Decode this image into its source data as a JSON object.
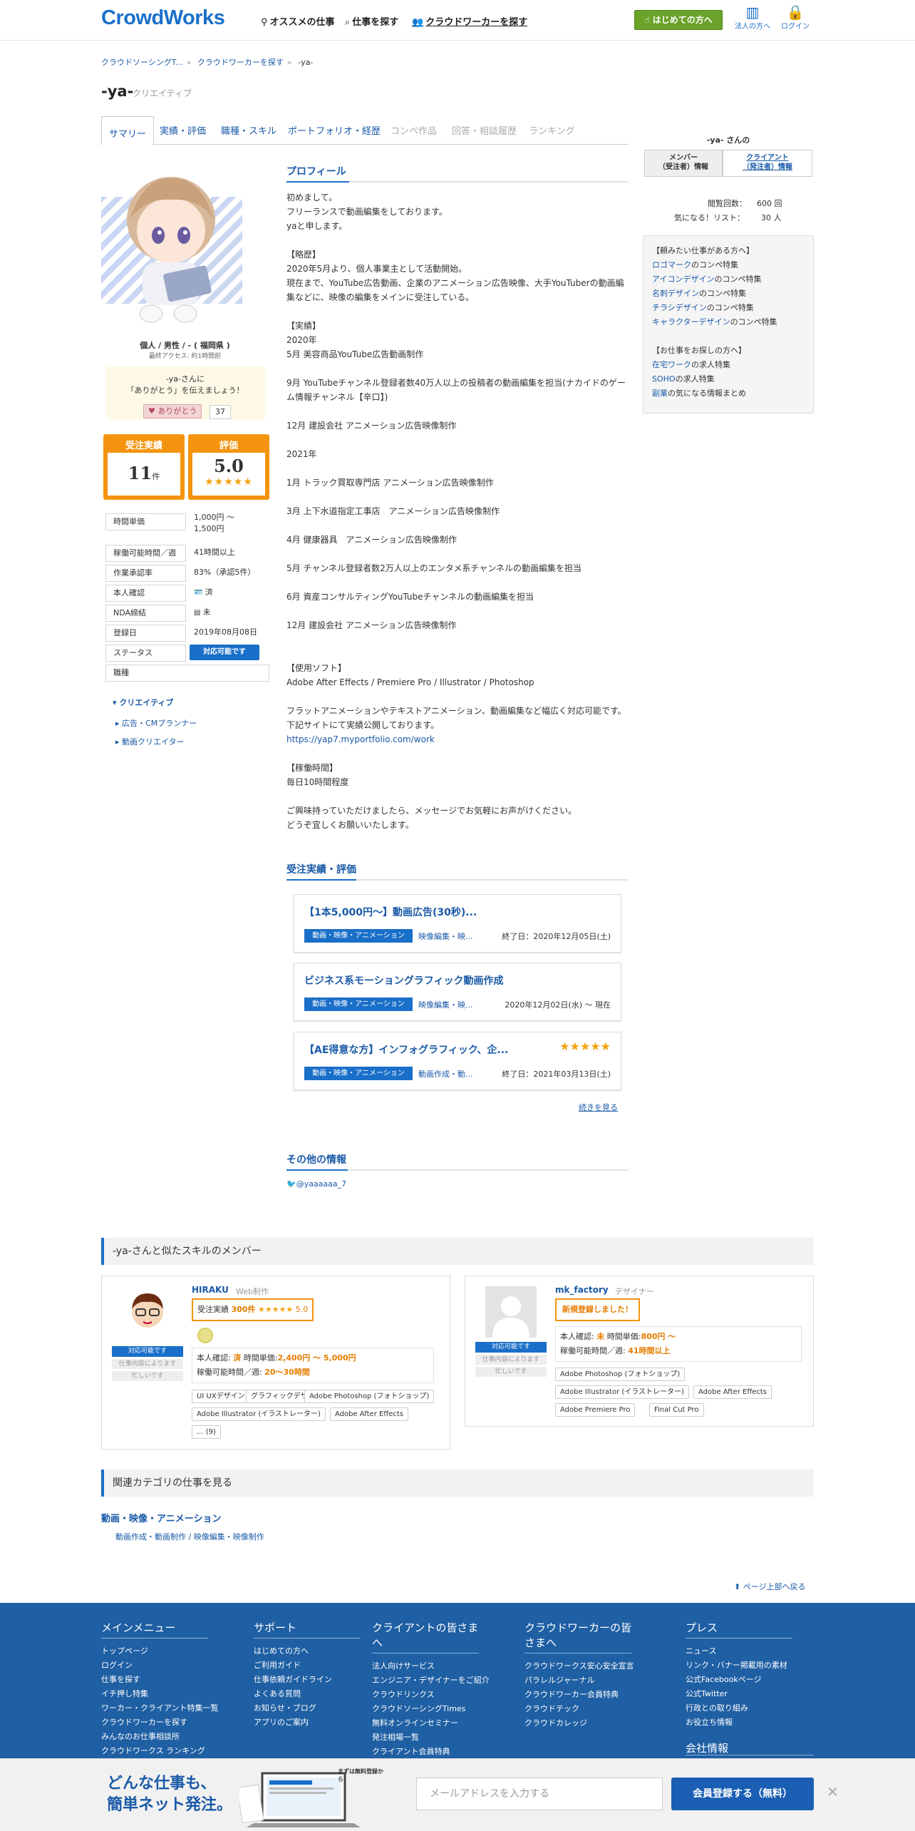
{
  "header": {
    "logo": "CrowdWorks",
    "nav": [
      "オススメの仕事",
      "仕事を探す",
      "クラウドワーカーを探す"
    ],
    "begin_button": "はじめての方へ",
    "corp_label": "法人の方へ",
    "login_label": "ログイン"
  },
  "breadcrumb": [
    "クラウドソーシングT...",
    "クラウドワーカーを探す",
    "-ya-"
  ],
  "profile": {
    "name": "-ya-",
    "type": "クリエイティブ",
    "tabs": [
      "サマリー",
      "実績・評価",
      "職種・スキル",
      "ポートフォリオ・経歴",
      "コンペ作品",
      "回答・相談履歴",
      "ランキング"
    ],
    "info": "個人 / 男性 / - ( 福岡県 )",
    "last_access": "最終アクセス: 約1時間前",
    "thanks_line1": "-ya-さんに",
    "thanks_line2": "「ありがとう」を伝えましょう！",
    "thanks_button": "ありがとう",
    "thanks_count": "37",
    "orders_label": "受注実績",
    "orders_count": "11",
    "orders_unit": "件",
    "rating_label": "評価",
    "rating_value": "5.0",
    "rating_stars": 5
  },
  "details": [
    {
      "k": "時間単価",
      "v": "1,000円 〜",
      "v2": "1,500円"
    },
    {
      "k": "稼働可能時間／週",
      "v": "41時間以上"
    },
    {
      "k": "作業承認率",
      "v": "83%（承認5件）"
    },
    {
      "k": "本人確認",
      "v": "済"
    },
    {
      "k": "NDA締結",
      "v": "未"
    },
    {
      "k": "登録日",
      "v": "2019年08月08日"
    },
    {
      "k": "ステータス",
      "v": "対応可能です"
    },
    {
      "k": "職種",
      "v": ""
    }
  ],
  "categories": {
    "parent": "クリエイティブ",
    "children": [
      "広告・CMプランナー",
      "動画クリエイター"
    ]
  },
  "profile_section": {
    "heading": "プロフィール",
    "text": "初めまして。\nフリーランスで動画編集をしております。\nyaと申します。\n\n【略歴】\n2020年5月より、個人事業主として活動開始。\n現在まで、YouTube広告動画、企業のアニメーション広告映像、大手YouTuberの動画編集などに、映像の編集をメインに受注している。\n\n【実績】\n2020年\n5月 美容商品YouTube広告動画制作\n\n9月 YouTubeチャンネル登録者数40万人以上の投稿者の動画編集を担当(ナカイドのゲーム情報チャンネル【辛口】)\n\n12月 建設会社 アニメーション広告映像制作\n\n2021年\n\n1月 トラック買取専門店 アニメーション広告映像制作\n\n3月 上下水道指定工事店　アニメーション広告映像制作\n\n4月 健康器具　アニメーション広告映像制作\n\n5月 チャンネル登録者数2万人以上のエンタメ系チャンネルの動画編集を担当\n\n6月 資産コンサルティングYouTubeチャンネルの動画編集を担当\n\n12月 建設会社 アニメーション広告映像制作\n\n\n【使用ソフト】\nAdobe After Effects / Premiere Pro / Illustrator / Photoshop\n\nフラットアニメーションやテキストアニメーション、動画編集など幅広く対応可能です。\n下記サイトにて実績公開しております。",
    "link": "https://yap7.myportfolio.com/work",
    "text2": "【稼働時間】\n毎日10時間程度\n\nご興味持っていただけましたら、メッセージでお気軽にお声がけください。\nどうぞ宜しくお願いいたします。"
  },
  "orders_section": {
    "heading": "受注実績・評価",
    "jobs": [
      {
        "title": "【1本5,000円～】動画広告(30秒)...",
        "tag": "動画・映像・アニメーション",
        "cat": "映像編集・映...",
        "date": "終了日：2020年12月05日(土)",
        "stars": 0
      },
      {
        "title": "ビジネス系モーショングラフィック動画作成",
        "tag": "動画・映像・アニメーション",
        "cat": "映像編集・映...",
        "date": "2020年12月02日(水) 〜 現在",
        "stars": 0
      },
      {
        "title": "【AE得意な方】インフォグラフィック、企...",
        "tag": "動画・映像・アニメーション",
        "cat": "動画作成・動...",
        "date": "終了日：2021年03月13日(土)",
        "stars": 5
      }
    ],
    "more": "続きを見る"
  },
  "other_section": {
    "heading": "その他の情報",
    "twitter": "@yaaaaaa_7"
  },
  "sidebar": {
    "title": "-ya- さんの",
    "tab_member": "メンバー\n（受注者）情報",
    "tab_client": "クライアント\n（発注者）情報",
    "views_label": "閲覧回数：",
    "views_value": "600 回",
    "fav_label": "気になる！リスト：",
    "fav_value": "30 人",
    "lines": [
      {
        "t": "【頼みたい仕事がある方へ】",
        "link": ""
      },
      {
        "t": "のコンペ特集",
        "link": "ロゴマーク"
      },
      {
        "t": "のコンペ特集",
        "link": "アイコンデザイン"
      },
      {
        "t": "のコンペ特集",
        "link": "名刺デザイン"
      },
      {
        "t": "のコンペ特集",
        "link": "チラシデザイン"
      },
      {
        "t": "のコンペ特集",
        "link": "キャラクターデザイン"
      },
      {
        "t": "",
        "link": ""
      },
      {
        "t": "【お仕事をお探しの方へ】",
        "link": ""
      },
      {
        "t": "の求人特集",
        "link": "在宅ワーク"
      },
      {
        "t": "の求人特集",
        "link": "SOHO"
      },
      {
        "t": "の気になる情報まとめ",
        "link": "副業"
      }
    ]
  },
  "similar": {
    "heading": "-ya-さんと似たスキルのメンバー",
    "members": [
      {
        "name": "HIRAKU",
        "type": "Web制作",
        "badge_prefix": "受注実績",
        "badge_value": "300件",
        "badge_rating": "5.0",
        "status": "対応可能です",
        "status2": "仕事内容によります",
        "status3": "忙しいです",
        "verify": "本人確認:",
        "verify_v": "済",
        "rate_label": "時間単価:",
        "rate": "2,400円 〜 5,000円",
        "hours_label": "稼働可能時間／週:",
        "hours": "20〜30時間",
        "skills": [
          "UI UXデザイン",
          "グラフィックデザイン",
          "Adobe Photoshop (フォトショップ)",
          "Adobe Illustrator (イラストレーター)",
          "Adobe After Effects",
          "... (9)"
        ]
      },
      {
        "name": "mk_factory",
        "type": "デザイナー",
        "badge_new": "新規登録しました！",
        "status": "対応可能です",
        "status2": "仕事内容によります",
        "status3": "忙しいです",
        "verify": "本人確認:",
        "verify_v": "未",
        "rate_label": "時間単価:",
        "rate": "800円 〜",
        "hours_label": "稼働可能時間／週:",
        "hours": "41時間以上",
        "skills": [
          "Adobe Photoshop (フォトショップ)",
          "Adobe Illustrator (イラストレーター)",
          "Adobe After Effects",
          "Adobe Premiere Pro",
          "Final Cut Pro"
        ]
      }
    ]
  },
  "related": {
    "heading": "関連カテゴリの仕事を見る",
    "category": "動画・映像・アニメーション",
    "sub": "動画作成・動画制作 / 映像編集・映像制作"
  },
  "page_top": "ページ上部へ戻る",
  "footer": {
    "cols": [
      {
        "h": "メインメニュー",
        "items": [
          "トップページ",
          "ログイン",
          "仕事を探す",
          "イチ押し特集",
          "ワーカー・クライアント特集一覧",
          "クラウドワーカーを探す",
          "みんなのお仕事相談所",
          "クラウドワークス ランキング"
        ]
      },
      {
        "h": "サポート",
        "items": [
          "はじめての方へ",
          "ご利用ガイド",
          "仕事依頼ガイドライン",
          "よくある質問",
          "お知らせ・ブログ",
          "アプリのご案内"
        ]
      },
      {
        "h": "クライアントの皆さまへ",
        "items": [
          "法人向けサービス",
          "エンジニア・デザイナーをご紹介",
          "クラウドリンクス",
          "クラウドソーシングTimes",
          "無料オンラインセミナー",
          "発注相場一覧",
          "クライアント会員特典"
        ]
      },
      {
        "h": "クラウドワーカーの皆さまへ",
        "items": [
          "クラウドワークス安心安全宣言",
          "パラレルジャーナル",
          "クラウドワーカー会員特典",
          "クラウドテック",
          "クラウドカレッジ"
        ]
      },
      {
        "h": "プレス",
        "items": [
          "ニュース",
          "リンク・バナー掲載用の素材",
          "公式Facebookページ",
          "公式Twitter",
          "行政との取り組み",
          "お役立ち情報"
        ]
      }
    ],
    "company": "会社情報"
  },
  "bottom_bar": {
    "line1": "どんな仕事も、",
    "line2": "簡単ネット発注。",
    "stamp": "まずは無料登録から！",
    "placeholder": "メールアドレスを入力する",
    "button": "会員登録する（無料）"
  },
  "colors": {
    "brand": "#1a6fc9",
    "orange": "#f4940e",
    "green": "#6aa22a",
    "footer": "#1f5fa3"
  }
}
